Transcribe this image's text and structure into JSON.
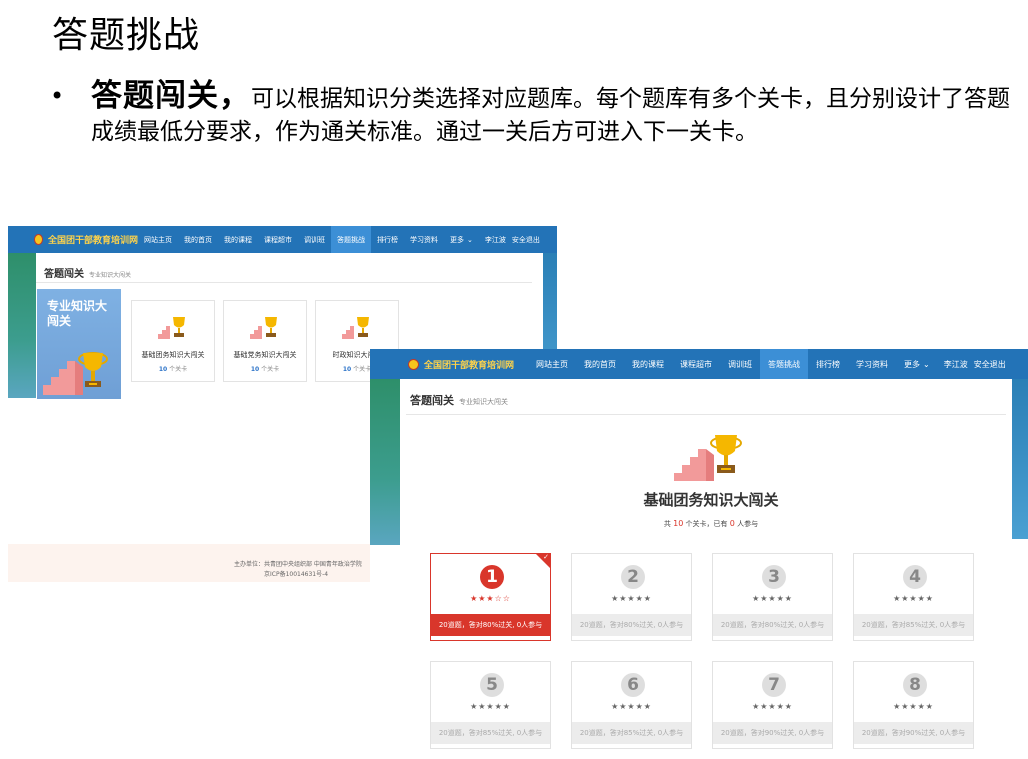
{
  "slide": {
    "title": "答题挑战",
    "bullet_mark": "•",
    "bullet_lead": "答题闯关，",
    "bullet_text": "可以根据知识分类选择对应题库。每个题库有多个关卡，且分别设计了答题成绩最低分要求，作为通关标准。通过一关后方可进入下一关卡。"
  },
  "site": {
    "logo_text": "全国团干部教育培训网",
    "nav": [
      "网站主页",
      "我的首页",
      "我的课程",
      "课程超市",
      "调训班",
      "答题挑战",
      "排行榜",
      "学习资料",
      "更多"
    ],
    "active_nav": "答题挑战",
    "more_chevron": "⌄",
    "user": "李江波",
    "logout": "安全退出",
    "colors": {
      "nav_bar": "#2373b7",
      "nav_active": "#3c8fd6",
      "accent_red": "#d9362b",
      "card_blue": "#7fb1e3",
      "count_blue": "#2c73c8"
    }
  },
  "back": {
    "breadcrumb_title": "答题闯关",
    "breadcrumb_sub": "专业知识大闯关",
    "category_title": "专业知识大闯关",
    "banks": [
      {
        "name": "基础团务知识大闯关",
        "count": "10",
        "unit": "个关卡"
      },
      {
        "name": "基础党务知识大闯关",
        "count": "10",
        "unit": "个关卡"
      },
      {
        "name": "时政知识大闯关",
        "count": "10",
        "unit": "个关卡"
      }
    ],
    "footer_line1": "主办单位：共青团中央组织部 中国青年政治学院",
    "footer_line2": "京ICP备10014631号-4"
  },
  "front": {
    "breadcrumb_title": "答题闯关",
    "breadcrumb_sub": "专业知识大闯关",
    "bank_title": "基础团务知识大闯关",
    "meta_prefix": "共",
    "meta_levels": "10",
    "meta_mid": "个关卡，已有",
    "meta_participants": "0",
    "meta_suffix": "人参与",
    "levels": [
      {
        "number": "1",
        "stars": "★★★☆☆",
        "rule": "20道题，答对80%过关, 0人参与",
        "state": "current"
      },
      {
        "number": "2",
        "stars": "★★★★★",
        "rule": "20道题，答对80%过关, 0人参与",
        "state": "locked"
      },
      {
        "number": "3",
        "stars": "★★★★★",
        "rule": "20道题，答对80%过关, 0人参与",
        "state": "locked"
      },
      {
        "number": "4",
        "stars": "★★★★★",
        "rule": "20道题，答对85%过关, 0人参与",
        "state": "locked"
      },
      {
        "number": "5",
        "stars": "★★★★★",
        "rule": "20道题，答对85%过关, 0人参与",
        "state": "locked"
      },
      {
        "number": "6",
        "stars": "★★★★★",
        "rule": "20道题，答对85%过关, 0人参与",
        "state": "locked"
      },
      {
        "number": "7",
        "stars": "★★★★★",
        "rule": "20道题，答对90%过关, 0人参与",
        "state": "locked"
      },
      {
        "number": "8",
        "stars": "★★★★★",
        "rule": "20道题，答对90%过关, 0人参与",
        "state": "locked"
      }
    ],
    "corner_tick": "✓"
  },
  "icons": {
    "logo": "league-emblem-icon",
    "trophy": "trophy-on-stairs-icon",
    "more": "chevron-down-icon",
    "corner": "checkmark-corner-icon"
  }
}
